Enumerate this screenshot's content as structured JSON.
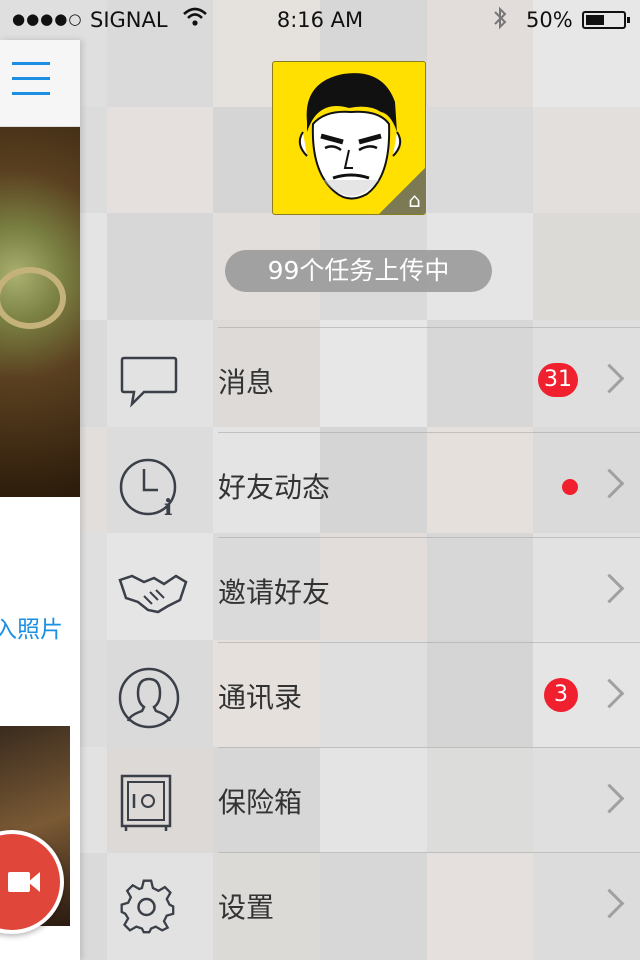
{
  "status_bar": {
    "signal_dots": "●●●●○",
    "carrier": "SIGNAL",
    "time": "8:16 AM",
    "battery": "50%",
    "battery_level": 0.5
  },
  "left_panel": {
    "import_label": "入照片"
  },
  "profile": {
    "upload_status": "99个任务上传中"
  },
  "menu": [
    {
      "label": "消息",
      "icon": "message-bubble-icon",
      "badge": "31"
    },
    {
      "label": "好友动态",
      "icon": "clock-info-icon",
      "dot": true
    },
    {
      "label": "邀请好友",
      "icon": "handshake-icon"
    },
    {
      "label": "通讯录",
      "icon": "contact-person-icon",
      "badge": "3"
    },
    {
      "label": "保险箱",
      "icon": "safe-icon"
    },
    {
      "label": "设置",
      "icon": "gear-icon"
    }
  ],
  "colors": {
    "accent_blue": "#1a8fe3",
    "badge_red": "#f0202e",
    "avatar_yellow": "#ffe000",
    "camera_button": "#e0463a"
  }
}
